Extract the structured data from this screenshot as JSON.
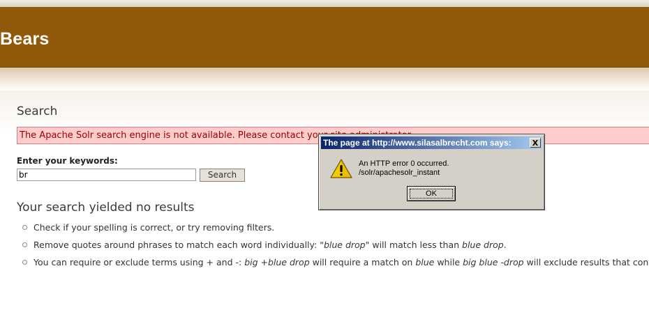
{
  "site": {
    "title": "Bears"
  },
  "search": {
    "heading": "Search",
    "error_message": "The Apache Solr search engine is not available. Please contact your site administrator.",
    "keywords_label": "Enter your keywords:",
    "keywords_value": "br",
    "button_label": "Search"
  },
  "results": {
    "heading": "Your search yielded no results",
    "tips": {
      "tip1": "Check if your spelling is correct, or try removing filters.",
      "tip2_a": "Remove quotes around phrases to match each word individually: ",
      "tip2_b": "\"blue drop\"",
      "tip2_c": " will match less than ",
      "tip2_d": "blue drop",
      "tip2_e": ".",
      "tip3_a": "You can require or exclude terms using + and -: ",
      "tip3_b": "big +blue drop",
      "tip3_c": " will require a match on ",
      "tip3_d": "blue",
      "tip3_e": " while ",
      "tip3_f": "big blue -drop",
      "tip3_g": " will exclude results that contain "
    }
  },
  "dialog": {
    "title": "The page at http://www.silasalbrecht.com says:",
    "close_label": "X",
    "message_line1": "An HTTP error 0 occurred.",
    "message_line2": "/solr/apachesolr_instant",
    "ok_label": "OK",
    "icon": "warning-icon"
  },
  "colors": {
    "header_brown": "#92590a",
    "error_bg": "#ffcccc",
    "error_text": "#9b0000",
    "dialog_titlebar": "#0a246a"
  }
}
